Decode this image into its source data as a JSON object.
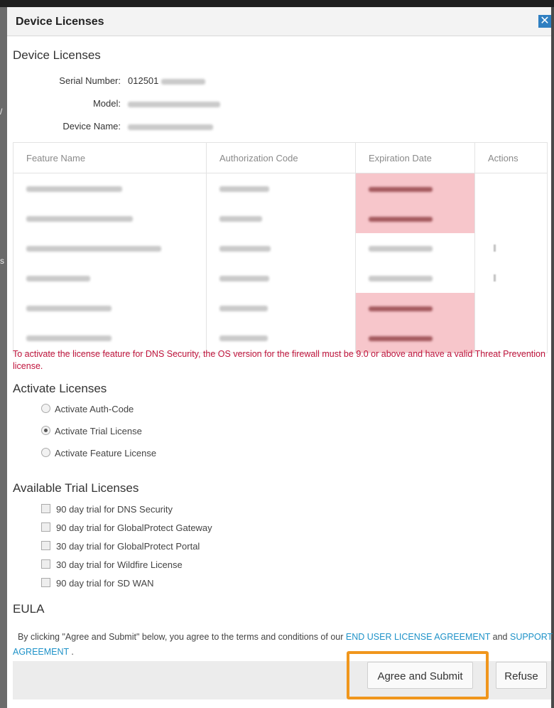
{
  "dialog": {
    "title": "Device Licenses",
    "close_icon": "close-icon"
  },
  "device": {
    "heading": "Device Licenses",
    "serial_label": "Serial Number:",
    "serial_value": "012501",
    "model_label": "Model:",
    "device_name_label": "Device Name:"
  },
  "table": {
    "headers": [
      "Feature Name",
      "Authorization Code",
      "Expiration Date",
      "Actions"
    ],
    "rows_count": 6,
    "expired_rows": [
      0,
      1,
      4,
      5
    ],
    "rows_with_action": [
      2,
      3
    ],
    "expired_color": "#f7c6cb"
  },
  "warning": {
    "text": "To activate the license feature for DNS Security, the OS version for the firewall must be 9.0 or above and have a valid Threat Prevention license.",
    "color": "#c0143c"
  },
  "activate": {
    "heading": "Activate Licenses",
    "options": [
      "Activate Auth-Code",
      "Activate Trial License",
      "Activate Feature License"
    ],
    "selected": "Activate Trial License"
  },
  "trials": {
    "heading": "Available Trial Licenses",
    "items": [
      "90 day trial for DNS Security",
      "90 day trial for GlobalProtect Gateway",
      "30 day trial for GlobalProtect Portal",
      "30 day trial for Wildfire License",
      "90 day trial for SD WAN"
    ]
  },
  "eula": {
    "heading": "EULA",
    "text_before": "By clicking \"Agree and Submit\" below, you agree to the terms and conditions of our ",
    "link1": "END USER LICENSE AGREEMENT",
    "text_mid": " and ",
    "link2": "SUPPORT AGREEMENT",
    "text_after": " .",
    "link_color": "#1e92c8"
  },
  "buttons": {
    "agree": "Agree and Submit",
    "refuse": "Refuse",
    "highlight_color": "#f0961c"
  }
}
